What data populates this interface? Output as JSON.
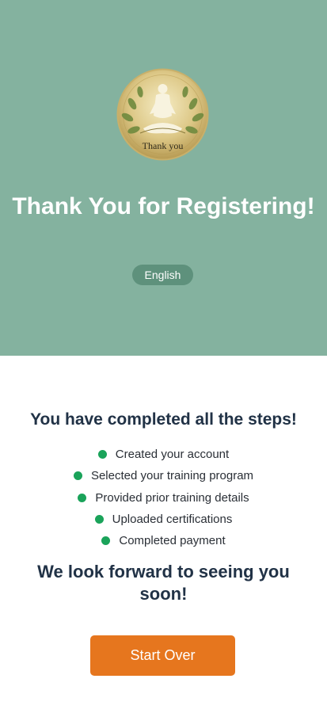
{
  "hero": {
    "logo_icon": "meditation-thank-you-icon",
    "logo_text": "Thank you",
    "title": "Thank You for Registering!",
    "language": "English",
    "background_color": "#84b29f"
  },
  "main": {
    "heading": "You have completed all the steps!",
    "steps": [
      {
        "label": "Created your account",
        "status_icon": "green-dot"
      },
      {
        "label": "Selected your training program",
        "status_icon": "green-dot"
      },
      {
        "label": "Provided prior training details",
        "status_icon": "green-dot"
      },
      {
        "label": "Uploaded certifications",
        "status_icon": "green-dot"
      },
      {
        "label": "Completed payment",
        "status_icon": "green-dot"
      }
    ],
    "closing": "We look forward to seeing you soon!",
    "start_over_label": "Start Over",
    "accent_color": "#e6761e",
    "check_color": "#1aa35a"
  }
}
